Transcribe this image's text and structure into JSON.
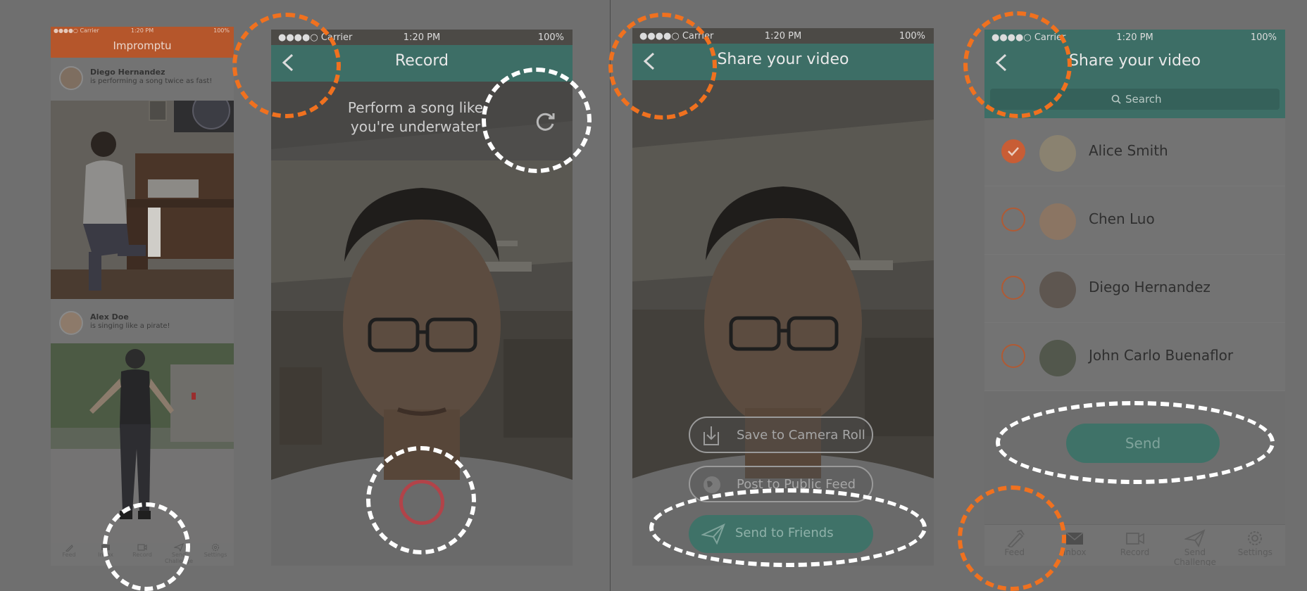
{
  "colors": {
    "background": "#6f6f6f",
    "accent_orange_bar": "#b5562b",
    "accent_teal_bar": "#3d6e66",
    "send_button": "#3f7268",
    "check_orange": "#c85d35",
    "annotation_orange": "#f0711f",
    "annotation_white": "#ffffff",
    "record_ring": "#b24349"
  },
  "feed": {
    "status": {
      "carrier": "●●●●○ Carrier",
      "time": "1:20 PM",
      "battery": "100%"
    },
    "title": "Impromptu",
    "posts": [
      {
        "user": "Diego Hernandez",
        "caption": "is performing a song twice as fast!"
      },
      {
        "user": "Alex Doe",
        "caption": "is singing like a pirate!"
      }
    ],
    "tabs": [
      "Feed",
      "Inbox",
      "Record",
      "Send Challenge",
      "Settings"
    ]
  },
  "record": {
    "status": {
      "carrier": "●●●●○ Carrier",
      "time": "1:20 PM",
      "battery": "100%"
    },
    "title": "Record",
    "prompt": "Perform a song like you're underwater"
  },
  "share": {
    "status": {
      "carrier": "●●●●○ Carrier",
      "time": "1:20 PM",
      "battery": "100%"
    },
    "title": "Share your video",
    "buttons": {
      "save": "Save to Camera Roll",
      "post": "Post to Public Feed",
      "send": "Send to Friends"
    }
  },
  "friends": {
    "status": {
      "carrier": "●●●●○ Carrier",
      "time": "1:20 PM",
      "battery": "100%"
    },
    "title": "Share your video",
    "search_placeholder": "Search",
    "contacts": [
      {
        "name": "Alice Smith",
        "selected": true
      },
      {
        "name": "Chen Luo",
        "selected": false
      },
      {
        "name": "Diego Hernandez",
        "selected": false
      },
      {
        "name": "John Carlo Buenaflor",
        "selected": false
      }
    ],
    "send_label": "Send",
    "tabs": [
      "Feed",
      "Inbox",
      "Record",
      "Send Challenge",
      "Settings"
    ]
  }
}
